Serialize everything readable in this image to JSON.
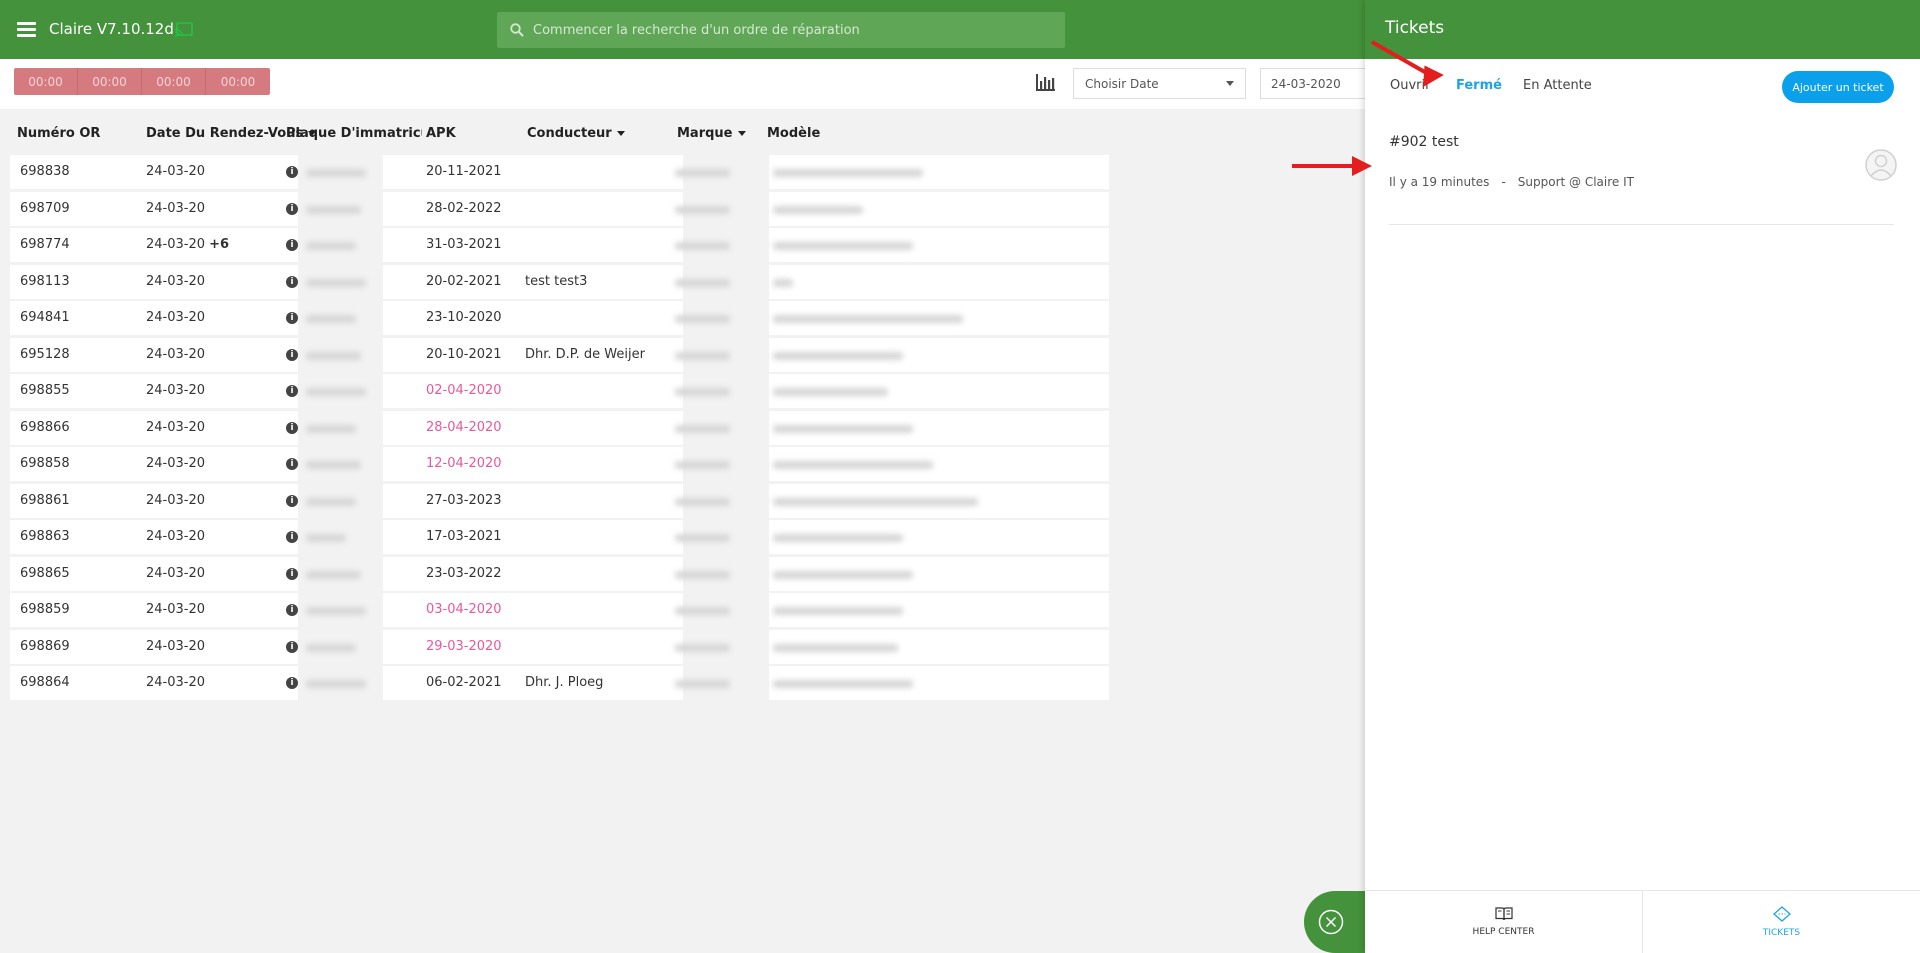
{
  "header": {
    "app_title": "Claire V7.10.12d",
    "search_placeholder": "Commencer la recherche d'un ordre de réparation"
  },
  "toolbar": {
    "timers": [
      "00:00",
      "00:00",
      "00:00",
      "00:00"
    ],
    "date_select_label": "Choisir Date",
    "date_value": "24-03-2020"
  },
  "table": {
    "headers": {
      "or": "Numéro OR",
      "date": "Date Du Rendez-Vous",
      "plate": "Plaque D'immatriculatio",
      "apk": "APK",
      "driver": "Conducteur",
      "brand": "Marque",
      "model": "Modèle"
    },
    "rows": [
      {
        "or": "698838",
        "date": "24-03-20",
        "extra": "",
        "apk": "20-11-2021",
        "apk_red": false,
        "driver": ""
      },
      {
        "or": "698709",
        "date": "24-03-20",
        "extra": "",
        "apk": "28-02-2022",
        "apk_red": false,
        "driver": ""
      },
      {
        "or": "698774",
        "date": "24-03-20",
        "extra": "+6",
        "apk": "31-03-2021",
        "apk_red": false,
        "driver": ""
      },
      {
        "or": "698113",
        "date": "24-03-20",
        "extra": "",
        "apk": "20-02-2021",
        "apk_red": false,
        "driver": "test test3"
      },
      {
        "or": "694841",
        "date": "24-03-20",
        "extra": "",
        "apk": "23-10-2020",
        "apk_red": false,
        "driver": ""
      },
      {
        "or": "695128",
        "date": "24-03-20",
        "extra": "",
        "apk": "20-10-2021",
        "apk_red": false,
        "driver": "Dhr. D.P. de Weijer"
      },
      {
        "or": "698855",
        "date": "24-03-20",
        "extra": "",
        "apk": "02-04-2020",
        "apk_red": true,
        "driver": ""
      },
      {
        "or": "698866",
        "date": "24-03-20",
        "extra": "",
        "apk": "28-04-2020",
        "apk_red": true,
        "driver": ""
      },
      {
        "or": "698858",
        "date": "24-03-20",
        "extra": "",
        "apk": "12-04-2020",
        "apk_red": true,
        "driver": ""
      },
      {
        "or": "698861",
        "date": "24-03-20",
        "extra": "",
        "apk": "27-03-2023",
        "apk_red": false,
        "driver": ""
      },
      {
        "or": "698863",
        "date": "24-03-20",
        "extra": "",
        "apk": "17-03-2021",
        "apk_red": false,
        "driver": ""
      },
      {
        "or": "698865",
        "date": "24-03-20",
        "extra": "",
        "apk": "23-03-2022",
        "apk_red": false,
        "driver": ""
      },
      {
        "or": "698859",
        "date": "24-03-20",
        "extra": "",
        "apk": "03-04-2020",
        "apk_red": true,
        "driver": ""
      },
      {
        "or": "698869",
        "date": "24-03-20",
        "extra": "",
        "apk": "29-03-2020",
        "apk_red": true,
        "driver": ""
      },
      {
        "or": "698864",
        "date": "24-03-20",
        "extra": "",
        "apk": "06-02-2021",
        "apk_red": false,
        "driver": "Dhr. J. Ploeg"
      }
    ]
  },
  "panel": {
    "title": "Tickets",
    "tabs": [
      {
        "label": "Ouvrir",
        "active": false
      },
      {
        "label": "Fermé",
        "active": true
      },
      {
        "label": "En Attente",
        "active": false
      }
    ],
    "add_button_label": "Ajouter un ticket",
    "ticket": {
      "title": "#902 test",
      "time": "Il y a 19 minutes",
      "separator": "-",
      "agent": "Support @ Claire IT"
    },
    "footer": [
      {
        "label": "HELP CENTER",
        "icon": "book-icon",
        "active": false
      },
      {
        "label": "TICKETS",
        "icon": "ticket-icon",
        "active": true
      }
    ]
  },
  "colors": {
    "brand_green": "#44923b",
    "accent_blue": "#1ea4e6",
    "apk_red": "#e8589c",
    "timer_red": "#d57a7f"
  }
}
